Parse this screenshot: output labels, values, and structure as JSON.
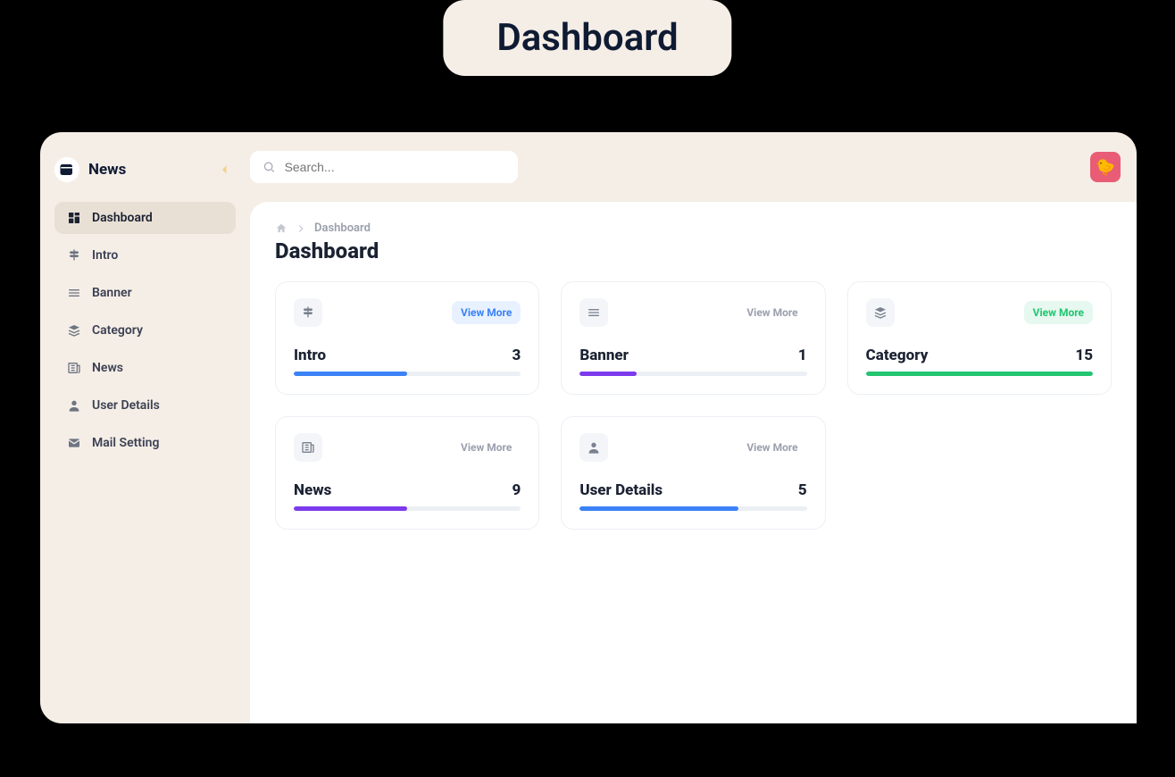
{
  "badge_title": "Dashboard",
  "brand": {
    "name": "News"
  },
  "search": {
    "placeholder": "Search..."
  },
  "sidebar": {
    "items": [
      {
        "label": "Dashboard",
        "active": true,
        "icon": "dashboard-icon"
      },
      {
        "label": "Intro",
        "active": false,
        "icon": "signpost-icon"
      },
      {
        "label": "Banner",
        "active": false,
        "icon": "lines-icon"
      },
      {
        "label": "Category",
        "active": false,
        "icon": "layers-icon"
      },
      {
        "label": "News",
        "active": false,
        "icon": "newspaper-icon"
      },
      {
        "label": "User Details",
        "active": false,
        "icon": "user-icon"
      },
      {
        "label": "Mail Setting",
        "active": false,
        "icon": "mail-icon"
      }
    ]
  },
  "breadcrumb": "Dashboard",
  "page_title": "Dashboard",
  "cards": [
    {
      "title": "Intro",
      "count": "3",
      "view_more": "View More",
      "vm_style": "vm-blue",
      "icon": "signpost-icon",
      "progress_pct": 50,
      "progress_color": "#3b82f6"
    },
    {
      "title": "Banner",
      "count": "1",
      "view_more": "View More",
      "vm_style": "vm-gray",
      "icon": "lines-icon",
      "progress_pct": 25,
      "progress_color": "#7c3aed"
    },
    {
      "title": "Category",
      "count": "15",
      "view_more": "View More",
      "vm_style": "vm-green",
      "icon": "layers-icon",
      "progress_pct": 100,
      "progress_color": "#22c570"
    },
    {
      "title": "News",
      "count": "9",
      "view_more": "View More",
      "vm_style": "vm-gray",
      "icon": "newspaper-icon",
      "progress_pct": 50,
      "progress_color": "#7c3aed"
    },
    {
      "title": "User Details",
      "count": "5",
      "view_more": "View More",
      "vm_style": "vm-gray",
      "icon": "user-icon",
      "progress_pct": 70,
      "progress_color": "#3b82f6"
    }
  ]
}
